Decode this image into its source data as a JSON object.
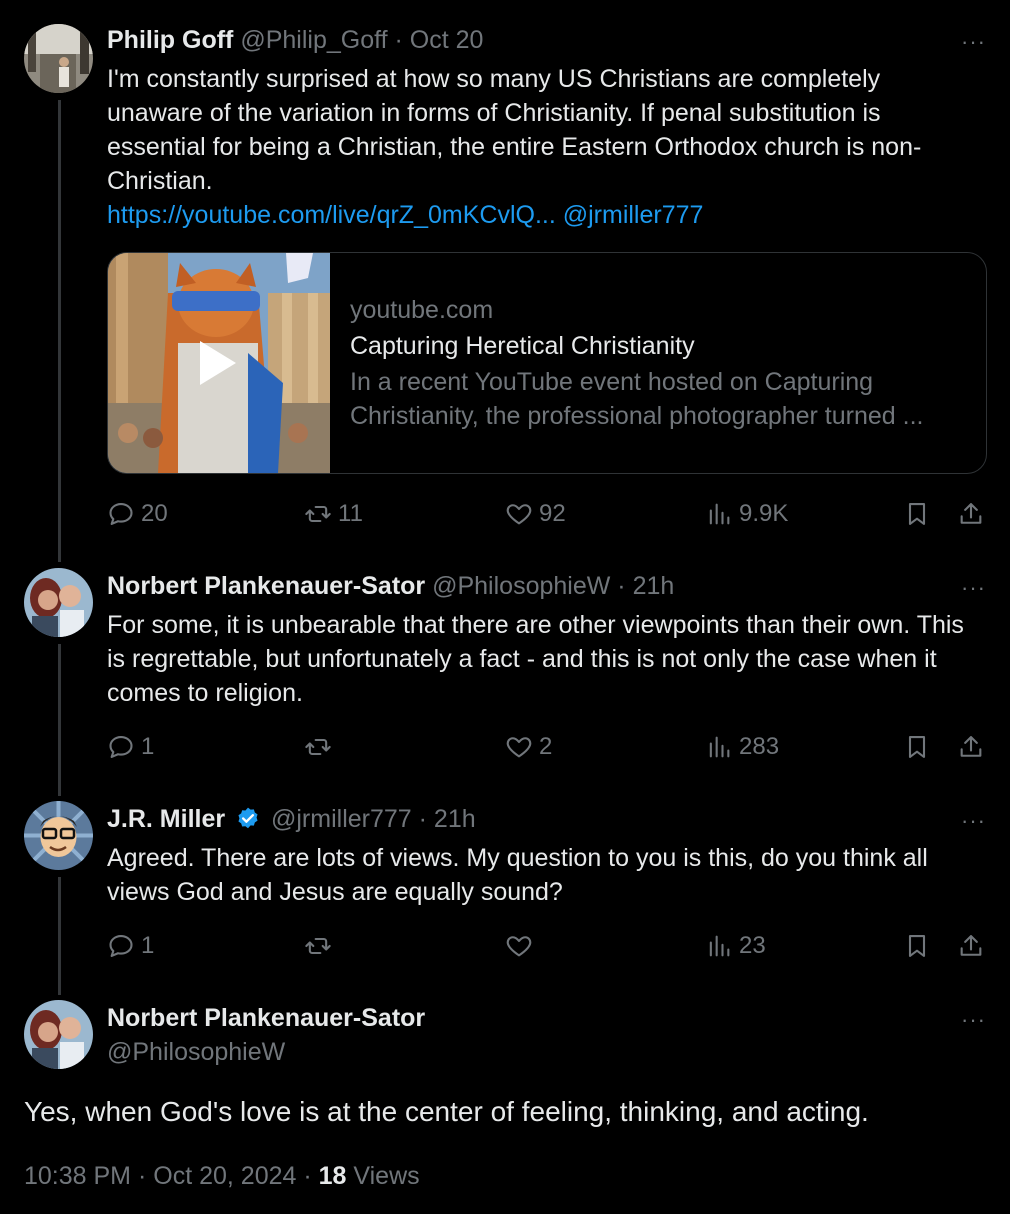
{
  "tweets": [
    {
      "name": "Philip Goff",
      "handle": "@Philip_Goff",
      "sep": "·",
      "time": "Oct 20",
      "text": "I'm constantly surprised at how so many US Christians are completely unaware of the variation in forms of Christianity. If penal substitution is essential for being a Christian, the entire Eastern Orthodox church is non-Christian.",
      "link": "https://youtube.com/live/qrZ_0mKCvlQ...",
      "mention": "@jrmiller777",
      "card": {
        "domain": "youtube.com",
        "title": "Capturing Heretical Christianity",
        "description": "In a recent YouTube event hosted on Capturing Christianity, the professional photographer turned ..."
      },
      "replies": "20",
      "reposts": "11",
      "likes": "92",
      "views": "9.9K"
    },
    {
      "name": "Norbert Plankenauer-Sator",
      "handle": "@PhilosophieW",
      "sep": "·",
      "time": "21h",
      "text": "For some, it is unbearable that there are other viewpoints than their own. This is regrettable, but unfortunately a fact - and this is not only the case when it comes to religion.",
      "replies": "1",
      "reposts": "",
      "likes": "2",
      "views": "283"
    },
    {
      "name": "J.R. Miller",
      "handle": "@jrmiller777",
      "sep": "·",
      "time": "21h",
      "text": "Agreed. There are lots of views. My question to you is this, do you think all views God and Jesus are equally sound?",
      "replies": "1",
      "reposts": "",
      "likes": "",
      "views": "23"
    }
  ],
  "main": {
    "name": "Norbert Plankenauer-Sator",
    "handle": "@PhilosophieW",
    "text": "Yes, when God's love is at the center of feeling, thinking, and acting.",
    "time": "10:38 PM",
    "sep": "·",
    "date": "Oct 20, 2024",
    "views_count": "18",
    "views_label": "Views"
  },
  "more_glyph": "···",
  "colors": {
    "background": "#000000",
    "text": "#e7e9ea",
    "muted": "#71767b",
    "link": "#1d9bf0",
    "border": "#2f3336"
  }
}
